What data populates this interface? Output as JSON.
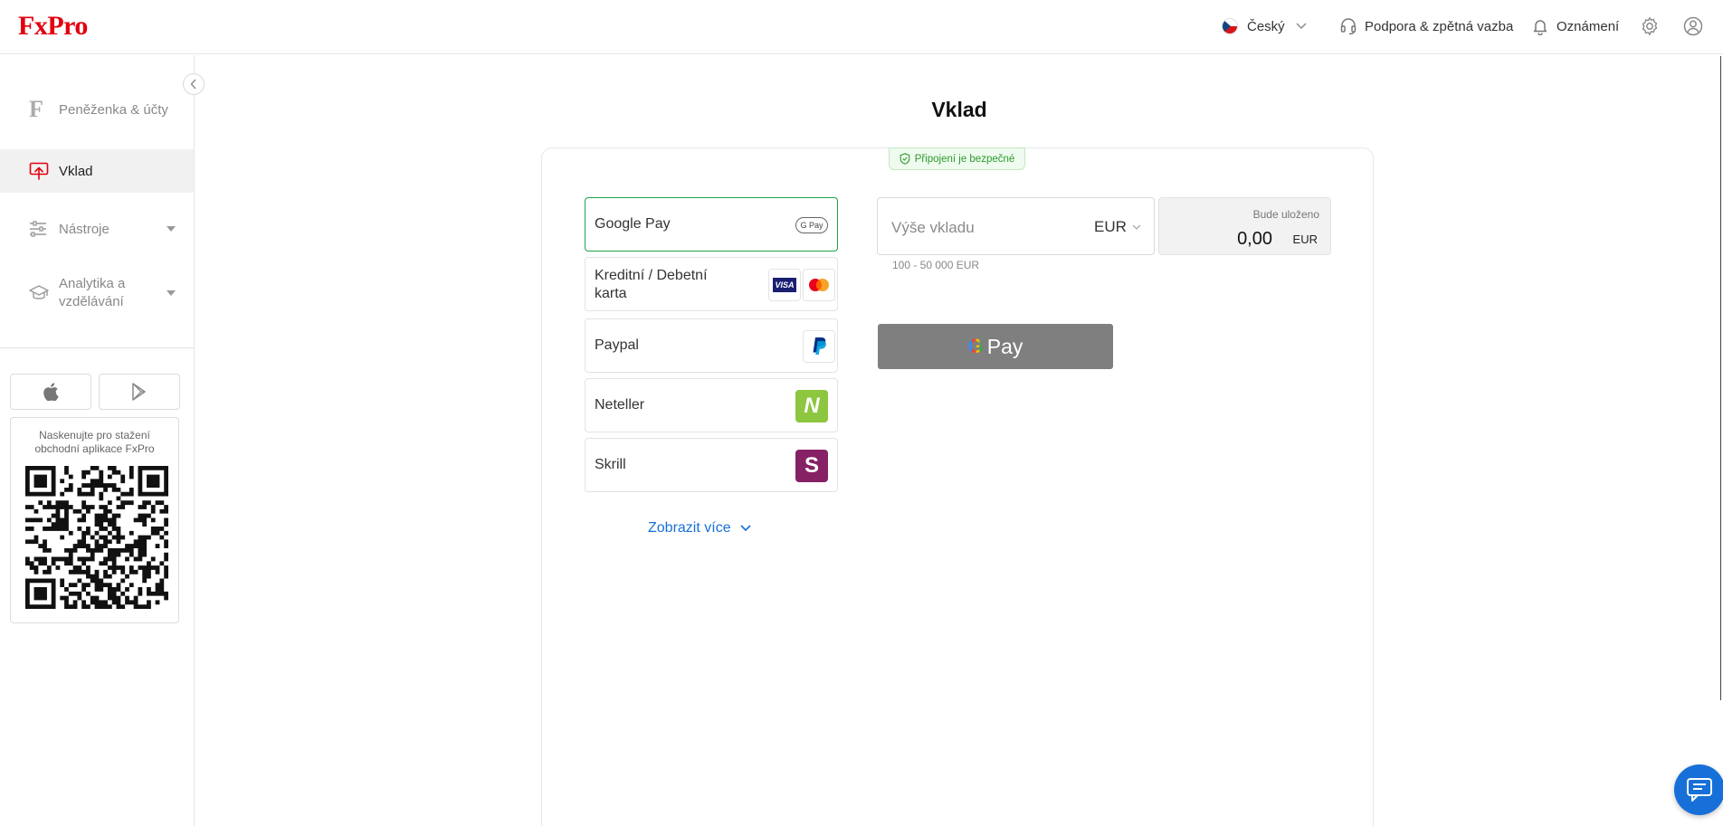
{
  "header": {
    "logo": "FxPro",
    "language": "Český",
    "support": "Podpora & zpětná vazba",
    "notifications": "Oznámení"
  },
  "sidebar": {
    "items": [
      {
        "label": "Peněženka & účty"
      },
      {
        "label": "Vklad"
      },
      {
        "label": "Nástroje"
      },
      {
        "label": "Analytika a vzdělávání"
      }
    ],
    "qr_text": "Naskenujte pro stažení obchodní aplikace FxPro"
  },
  "main": {
    "title": "Vklad",
    "secure": "Připojení je bezpečné",
    "methods": [
      {
        "label": "Google Pay",
        "logo": "G Pay"
      },
      {
        "label": "Kreditní / Debetní karta",
        "logo": "VISA"
      },
      {
        "label": "Paypal"
      },
      {
        "label": "Neteller",
        "logo": "N"
      },
      {
        "label": "Skrill",
        "logo": "S"
      }
    ],
    "show_more": "Zobrazit více",
    "amount_placeholder": "Výše vkladu",
    "currency": "EUR",
    "range": "100 - 50 000 EUR",
    "credited_caption": "Bude uloženo",
    "credited_value": "0,00",
    "credited_currency": "EUR",
    "gpay_g": "G",
    "gpay_text": "Pay"
  },
  "colors": {
    "brand_red": "#e3000f",
    "active_green": "#1fa34a",
    "link_blue": "#1670d8",
    "gpay_button": "#7f7f7f"
  }
}
